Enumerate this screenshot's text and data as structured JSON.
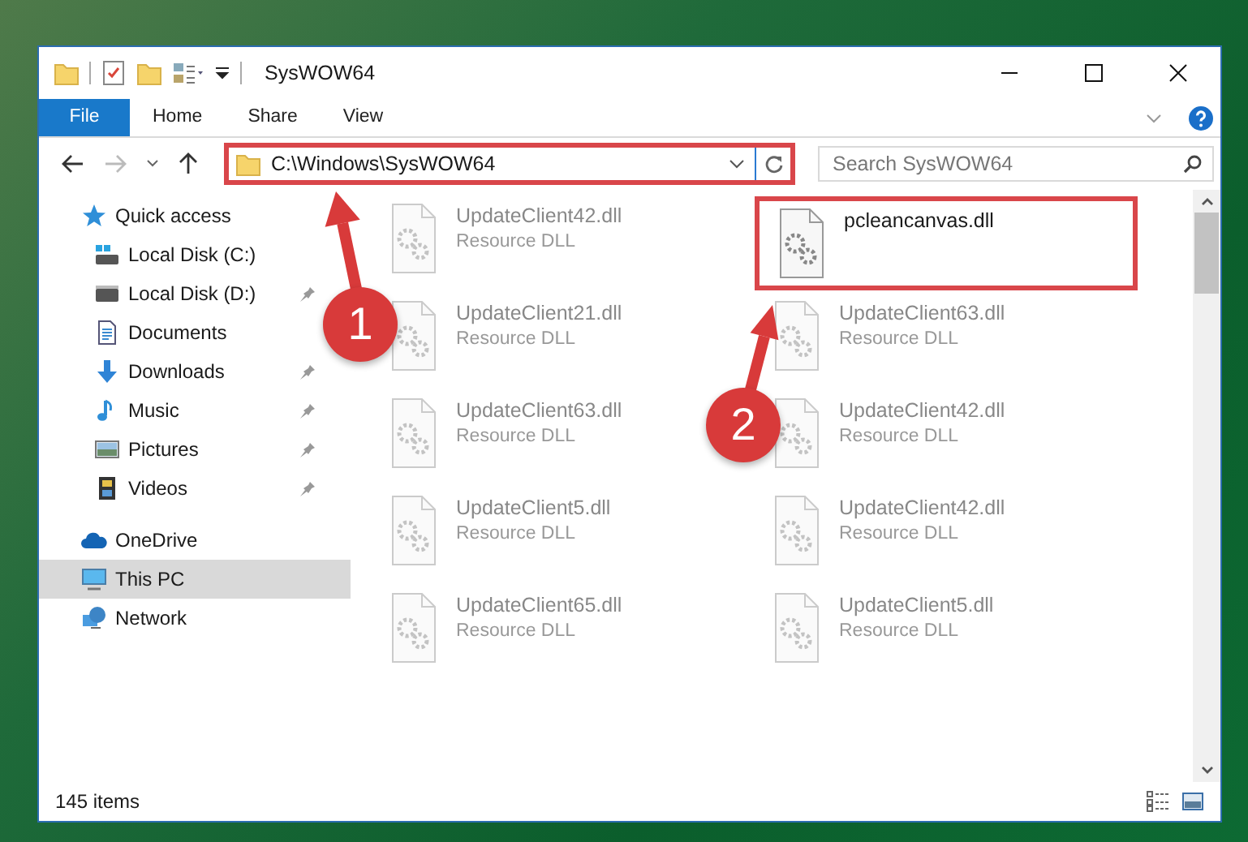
{
  "window": {
    "title": "SysWOW64"
  },
  "ribbon_tabs": [
    {
      "label": "File",
      "selected": true
    },
    {
      "label": "Home",
      "selected": false
    },
    {
      "label": "Share",
      "selected": false
    },
    {
      "label": "View",
      "selected": false
    }
  ],
  "address": {
    "path": "C:\\Windows\\SysWOW64",
    "highlighted": true
  },
  "search": {
    "placeholder": "Search SysWOW64"
  },
  "nav": [
    {
      "label": "Quick access",
      "selected": false,
      "children": [
        {
          "label": "Local Disk (C:)",
          "selected": false,
          "pinned": false
        },
        {
          "label": "Local Disk (D:)",
          "selected": false,
          "pinned": true
        },
        {
          "label": "Documents",
          "selected": false,
          "pinned": false
        },
        {
          "label": "Downloads",
          "selected": false,
          "pinned": true
        },
        {
          "label": "Music",
          "selected": false,
          "pinned": true
        },
        {
          "label": "Pictures",
          "selected": false,
          "pinned": true
        },
        {
          "label": "Videos",
          "selected": false,
          "pinned": true
        }
      ]
    },
    {
      "label": "OneDrive",
      "selected": false
    },
    {
      "label": "This PC",
      "selected": true
    },
    {
      "label": "Network",
      "selected": false
    }
  ],
  "files": [
    {
      "name": "UpdateClient42.dll",
      "type": "Resource DLL",
      "dimmed": true,
      "highlighted": false
    },
    {
      "name": "pcleancanvas.dll",
      "dimmed": false,
      "highlighted": true
    },
    {
      "name": "UpdateClient21.dll",
      "type": "Resource DLL",
      "dimmed": true,
      "highlighted": false
    },
    {
      "name": "UpdateClient63.dll",
      "type": "Resource DLL",
      "dimmed": true,
      "highlighted": false
    },
    {
      "name": "UpdateClient63.dll",
      "type": "Resource DLL",
      "dimmed": true,
      "highlighted": false
    },
    {
      "name": "UpdateClient42.dll",
      "type": "Resource DLL",
      "dimmed": true,
      "highlighted": false
    },
    {
      "name": "UpdateClient5.dll",
      "type": "Resource DLL",
      "dimmed": true,
      "highlighted": false
    },
    {
      "name": "UpdateClient42.dll",
      "type": "Resource DLL",
      "dimmed": true,
      "highlighted": false
    },
    {
      "name": "UpdateClient65.dll",
      "type": "Resource DLL",
      "dimmed": true,
      "highlighted": false
    },
    {
      "name": "UpdateClient5.dll",
      "type": "Resource DLL",
      "dimmed": true,
      "highlighted": false
    }
  ],
  "status_bar": {
    "item_count": "145 items"
  },
  "annotations": [
    {
      "number": "1"
    },
    {
      "number": "2"
    }
  ]
}
